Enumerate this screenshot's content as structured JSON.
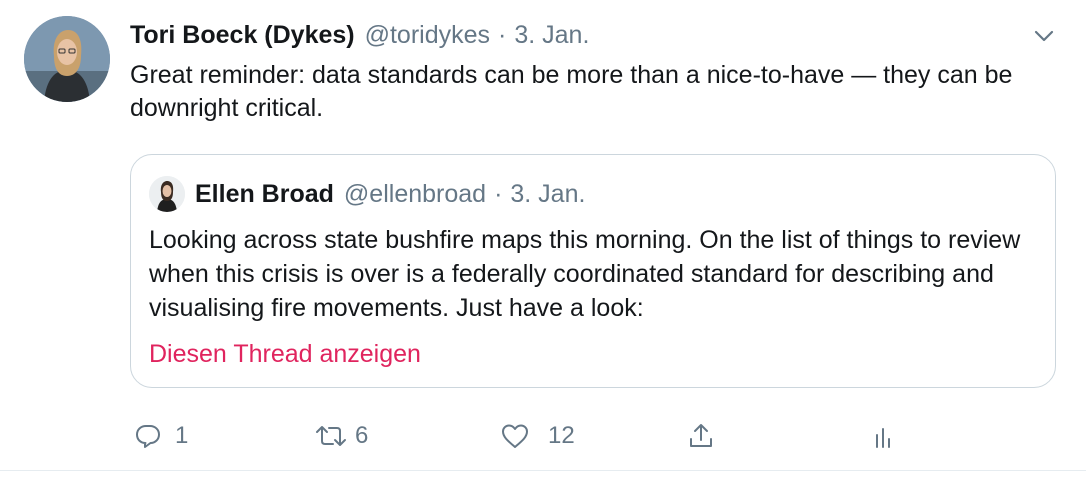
{
  "tweet": {
    "author_name": "Tori Boeck (Dykes)",
    "author_handle": "@toridykes",
    "separator": "·",
    "time": "3. Jan.",
    "text": "Great reminder: data standards can be more than a nice-to-have — they can be downright critical."
  },
  "quote": {
    "author_name": "Ellen Broad",
    "author_handle": "@ellenbroad",
    "separator": "·",
    "time": "3. Jan.",
    "text": "Looking across state bushfire maps this morning. On the list of things to review when this crisis is over is a federally coordinated standard for describing and visualising fire movements. Just have a look:",
    "show_thread": "Diesen Thread anzeigen"
  },
  "actions": {
    "reply_count": "1",
    "retweet_count": "6",
    "like_count": "12"
  },
  "icons": {
    "menu": "chevron-down-icon",
    "reply": "reply-icon",
    "retweet": "retweet-icon",
    "like": "heart-icon",
    "share": "share-icon",
    "analytics": "analytics-icon"
  },
  "colors": {
    "text": "#14171a",
    "secondary": "#657786",
    "link": "#e0245e",
    "border": "#ccd6dd"
  }
}
